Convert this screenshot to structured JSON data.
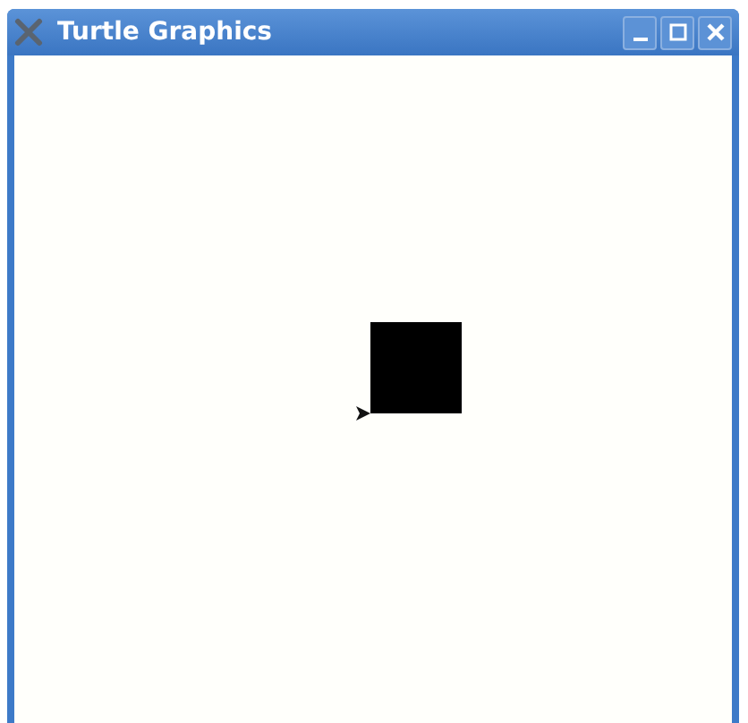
{
  "window": {
    "title": "Turtle Graphics"
  },
  "title_buttons": [
    {
      "kind": "minimize"
    },
    {
      "kind": "maximize"
    },
    {
      "kind": "close"
    }
  ]
}
